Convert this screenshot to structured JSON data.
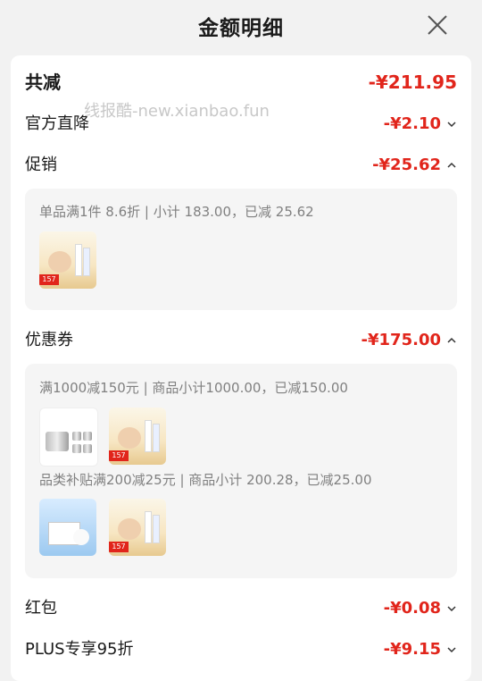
{
  "header": {
    "title": "金额明细",
    "close_icon": "close-icon"
  },
  "watermark": "线报酷-new.xianbao.fun",
  "summary": {
    "label": "共减",
    "amount": "-¥211.95"
  },
  "official_discount": {
    "label": "官方直降",
    "amount": "-¥2.10",
    "expanded": false
  },
  "promotion": {
    "label": "促销",
    "amount": "-¥25.62",
    "expanded": true,
    "rule": "单品满1件 8.6折 | 小计 183.00，已减 25.62",
    "products": [
      "product-a"
    ]
  },
  "coupon": {
    "label": "优惠券",
    "amount": "-¥175.00",
    "expanded": true,
    "groups": [
      {
        "rule": "满1000减150元 | 商品小计1000.00，已减150.00",
        "products": [
          "product-b",
          "product-a"
        ]
      },
      {
        "rule": "品类补贴满200减25元 | 商品小计 200.28，已减25.00",
        "products": [
          "product-c",
          "product-a"
        ]
      }
    ]
  },
  "red_packet": {
    "label": "红包",
    "amount": "-¥0.08",
    "expanded": false
  },
  "plus": {
    "label": "PLUS专享95折",
    "amount": "-¥9.15",
    "expanded": false
  },
  "product_badge": "157",
  "colors": {
    "accent": "#e1251b",
    "background": "#f2f2f2",
    "panel": "#f5f5f5"
  }
}
